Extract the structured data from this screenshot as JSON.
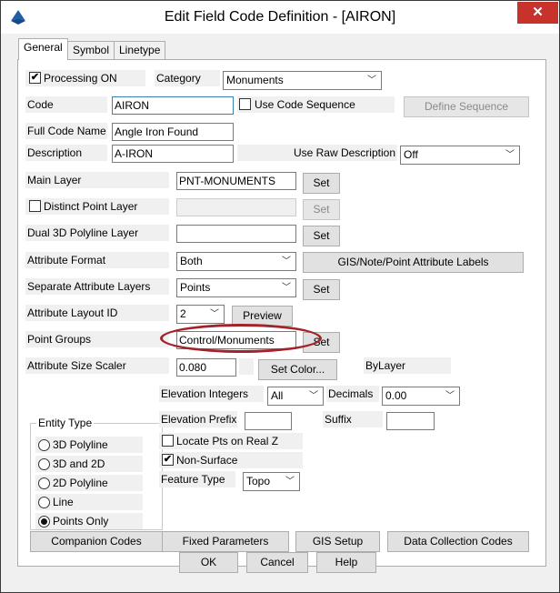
{
  "window": {
    "title": "Edit Field Code Definition - [AIRON]",
    "close_glyph": "✕",
    "icon": "app-icon"
  },
  "tabs": [
    {
      "label": "General",
      "active": true
    },
    {
      "label": "Symbol",
      "active": false
    },
    {
      "label": "Linetype",
      "active": false
    }
  ],
  "general": {
    "processing_on": {
      "label": "Processing ON",
      "checked": true
    },
    "category": {
      "label": "Category",
      "value": "Monuments"
    },
    "code": {
      "label": "Code",
      "value": "AIRON"
    },
    "use_code_sequence": {
      "label": "Use Code Sequence",
      "checked": false
    },
    "define_sequence_label": "Define Sequence",
    "full_code_name": {
      "label": "Full Code Name",
      "value": "Angle Iron Found"
    },
    "description": {
      "label": "Description",
      "value": "A-IRON"
    },
    "use_raw_description": {
      "label": "Use Raw Description",
      "value": "Off"
    },
    "main_layer": {
      "label": "Main Layer",
      "value": "PNT-MONUMENTS"
    },
    "distinct_point_layer": {
      "label": "Distinct Point Layer",
      "checked": false,
      "value": ""
    },
    "dual_3d_polyline_layer": {
      "label": "Dual 3D Polyline Layer",
      "value": ""
    },
    "attribute_format": {
      "label": "Attribute Format",
      "value": "Both"
    },
    "gis_labels_button": "GIS/Note/Point Attribute Labels",
    "separate_attribute_layers": {
      "label": "Separate Attribute Layers",
      "value": "Points"
    },
    "attribute_layout_id": {
      "label": "Attribute Layout ID",
      "value": "2"
    },
    "preview_label": "Preview",
    "point_groups": {
      "label": "Point Groups",
      "value": "Control/Monuments"
    },
    "attribute_size_scaler": {
      "label": "Attribute Size Scaler",
      "value": "0.080"
    },
    "set_color_label": "Set Color...",
    "bylayer_text": "ByLayer",
    "set_label": "Set",
    "entity_type": {
      "label": "Entity Type",
      "options": [
        {
          "label": "3D Polyline",
          "selected": false
        },
        {
          "label": "3D and 2D",
          "selected": false
        },
        {
          "label": "2D Polyline",
          "selected": false
        },
        {
          "label": "Line",
          "selected": false
        },
        {
          "label": "Points Only",
          "selected": true
        }
      ]
    },
    "elevation_integers": {
      "label": "Elevation Integers",
      "value": "All"
    },
    "decimals": {
      "label": "Decimals",
      "value": "0.00"
    },
    "elevation_prefix": {
      "label": "Elevation Prefix",
      "value": ""
    },
    "suffix": {
      "label": "Suffix",
      "value": ""
    },
    "locate_pts_on_real_z": {
      "label": "Locate Pts on Real Z",
      "checked": false
    },
    "non_surface": {
      "label": "Non-Surface",
      "checked": true
    },
    "feature_type": {
      "label": "Feature Type",
      "value": "Topo"
    }
  },
  "bottom_buttons": {
    "companion_codes": "Companion Codes",
    "fixed_parameters": "Fixed Parameters",
    "gis_setup": "GIS Setup",
    "data_collection_codes": "Data Collection Codes"
  },
  "dialog_buttons": {
    "ok": "OK",
    "cancel": "Cancel",
    "help": "Help"
  },
  "check_glyph": "✔",
  "dropdown_glyph": "﹀",
  "annotation": {
    "color": "#a0242a"
  },
  "colors": {
    "close_button": "#c7322a",
    "icon_blue": "#1f5fa6"
  }
}
